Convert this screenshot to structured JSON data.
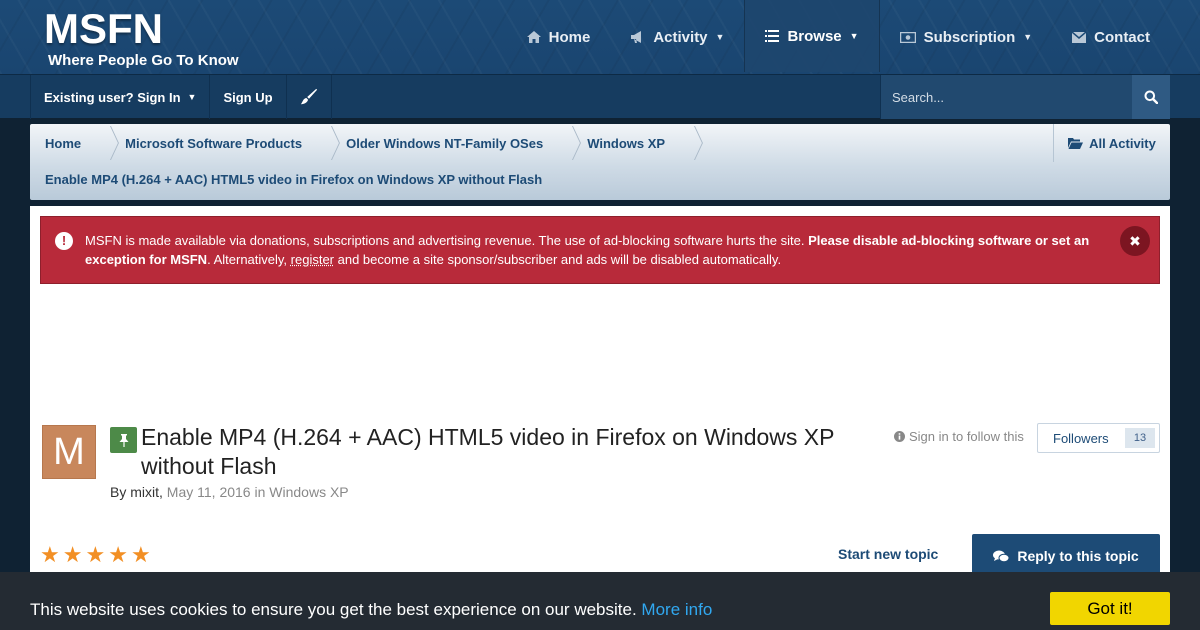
{
  "brand": {
    "title": "MSFN",
    "tagline": "Where People Go To Know"
  },
  "nav": [
    {
      "label": "Home",
      "icon": "home-icon",
      "caret": false,
      "active": false
    },
    {
      "label": "Activity",
      "icon": "megaphone-icon",
      "caret": true,
      "active": false
    },
    {
      "label": "Browse",
      "icon": "list-icon",
      "caret": true,
      "active": true
    },
    {
      "label": "Subscription",
      "icon": "money-icon",
      "caret": true,
      "active": false
    },
    {
      "label": "Contact",
      "icon": "envelope-icon",
      "caret": false,
      "active": false
    }
  ],
  "userbar": {
    "signin_label": "Existing user? Sign In",
    "signup_label": "Sign Up",
    "theme_icon": "paintbrush-icon"
  },
  "search": {
    "placeholder": "Search..."
  },
  "breadcrumb": {
    "items": [
      "Home",
      "Microsoft Software Products",
      "Older Windows NT-Family OSes",
      "Windows XP"
    ],
    "current": "Enable MP4 (H.264 + AAC) HTML5 video in Firefox on Windows XP without Flash",
    "all_activity": "All Activity"
  },
  "adblock_notice": {
    "part1": "MSFN is made available via donations, subscriptions and advertising revenue. The use of ad-blocking software hurts the site. ",
    "bold": "Please disable ad-blocking software or set an exception for MSFN",
    "part2": ". Alternatively, ",
    "link": "register",
    "part3": " and become a site sponsor/subscriber and ads will be disabled automatically."
  },
  "topic": {
    "avatar_letter": "M",
    "title": "Enable MP4 (H.264 + AAC) HTML5 video in Firefox on Windows XP without Flash",
    "by": "By",
    "author": "mixit",
    "date": "May 11, 2016",
    "in": "in",
    "forum": "Windows XP",
    "follow_label": "Sign in to follow this",
    "followers_label": "Followers",
    "followers_count": "13",
    "rating_stars": 5,
    "start_new_topic": "Start new topic",
    "reply_label": "Reply to this topic"
  },
  "cookie": {
    "message": "This website uses cookies to ensure you get the best experience on our website.",
    "more_info": "More info",
    "got_it": "Got it!"
  },
  "colors": {
    "header": "#1c4a76",
    "accent": "#1d4b76",
    "alert": "#b82a3a",
    "star": "#f28f24",
    "pin": "#4d8a48",
    "cookie_button": "#f1d600"
  }
}
